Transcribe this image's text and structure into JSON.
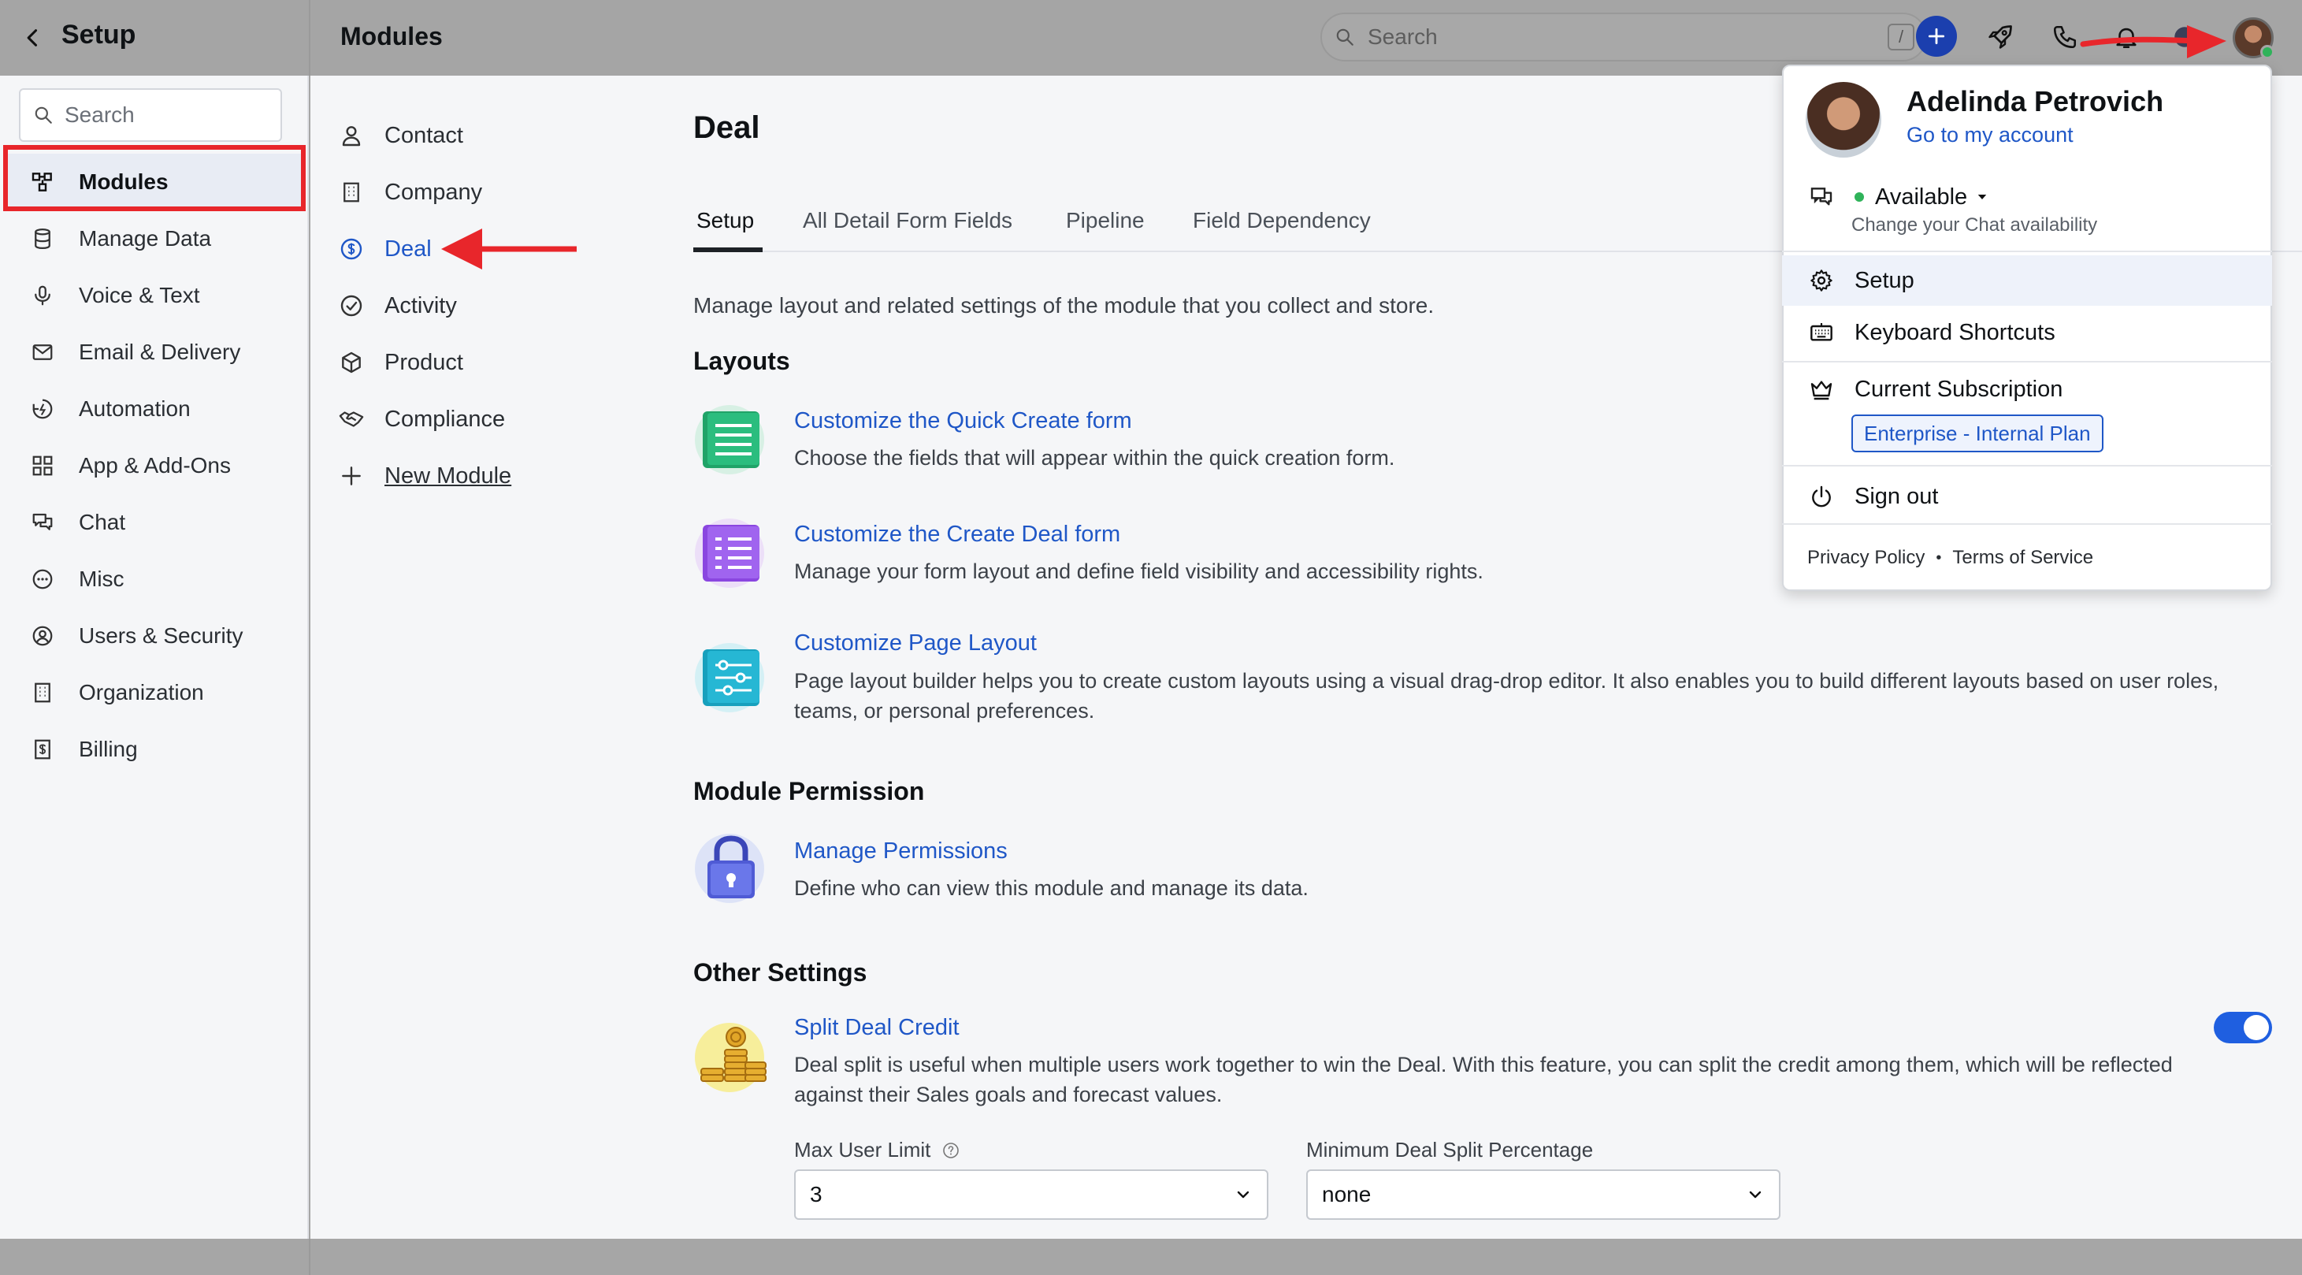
{
  "topbar": {
    "setup_title": "Setup",
    "page_title": "Modules",
    "search_placeholder": "Search",
    "search_shortcut": "/"
  },
  "sidebar": {
    "search_placeholder": "Search",
    "items": [
      {
        "label": "Modules",
        "icon": "modules-icon",
        "active": true
      },
      {
        "label": "Manage Data",
        "icon": "database-icon"
      },
      {
        "label": "Voice & Text",
        "icon": "microphone-icon"
      },
      {
        "label": "Email & Delivery",
        "icon": "mail-icon"
      },
      {
        "label": "Automation",
        "icon": "automation-icon"
      },
      {
        "label": "App & Add-Ons",
        "icon": "apps-grid-icon"
      },
      {
        "label": "Chat",
        "icon": "chat-icon"
      },
      {
        "label": "Misc",
        "icon": "more-circle-icon"
      },
      {
        "label": "Users & Security",
        "icon": "user-circle-icon"
      },
      {
        "label": "Organization",
        "icon": "building-icon"
      },
      {
        "label": "Billing",
        "icon": "billing-icon"
      }
    ]
  },
  "modules": {
    "items": [
      {
        "label": "Contact",
        "icon": "person-icon"
      },
      {
        "label": "Company",
        "icon": "company-icon"
      },
      {
        "label": "Deal",
        "icon": "dollar-circle-icon",
        "selected": true
      },
      {
        "label": "Activity",
        "icon": "check-circle-icon"
      },
      {
        "label": "Product",
        "icon": "cube-icon"
      },
      {
        "label": "Compliance",
        "icon": "handshake-icon"
      },
      {
        "label": "New Module",
        "icon": "plus-icon"
      }
    ]
  },
  "main": {
    "title": "Deal",
    "tabs": [
      {
        "label": "Setup",
        "active": true
      },
      {
        "label": "All Detail Form Fields"
      },
      {
        "label": "Pipeline"
      },
      {
        "label": "Field Dependency"
      }
    ],
    "description": "Manage layout and related settings of the module that you collect and store.",
    "layouts": {
      "heading": "Layouts",
      "items": [
        {
          "title": "Customize the Quick Create form",
          "desc": "Choose the fields that will appear within the quick creation form."
        },
        {
          "title": "Customize the Create Deal form",
          "desc": "Manage your form layout and define field visibility and accessibility rights."
        },
        {
          "title": "Customize Page Layout",
          "desc": "Page layout builder helps you to create custom layouts using a visual drag-drop editor. It also enables you to build different layouts based on user roles, teams, or personal preferences."
        }
      ]
    },
    "permission": {
      "heading": "Module Permission",
      "title": "Manage Permissions",
      "desc": "Define who can view this module and manage its data."
    },
    "other": {
      "heading": "Other Settings",
      "title": "Split Deal Credit",
      "desc": "Deal split is useful when multiple users work together to win the Deal. With this feature, you can split the credit among them, which will be reflected against their Sales goals and forecast values.",
      "toggle_on": true,
      "max_user_label": "Max User Limit",
      "max_user_value": "3",
      "min_split_label": "Minimum Deal Split Percentage",
      "min_split_value": "none"
    }
  },
  "account_menu": {
    "name": "Adelinda Petrovich",
    "link": "Go to my account",
    "availability": "Available",
    "availability_sub": "Change your Chat availability",
    "setup": "Setup",
    "shortcuts": "Keyboard Shortcuts",
    "subscription": "Current Subscription",
    "plan": "Enterprise - Internal Plan",
    "signout": "Sign out",
    "privacy": "Privacy Policy",
    "terms": "Terms of Service"
  },
  "colors": {
    "accent": "#1f57c7",
    "annotation_red": "#e8262b",
    "available_green": "#2fb35a"
  }
}
